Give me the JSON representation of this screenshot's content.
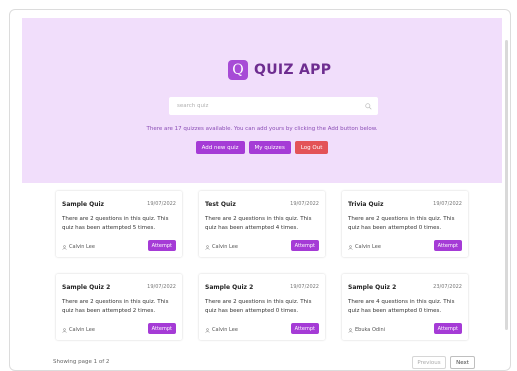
{
  "app": {
    "title": "QUIZ APP",
    "logo_letter": "Q"
  },
  "search": {
    "placeholder": "search quiz"
  },
  "info_text": "There are 17 quizzes available. You can add yours by clicking the Add button below.",
  "buttons": {
    "add": "Add new quiz",
    "mine": "My quizzes",
    "logout": "Log Out"
  },
  "quizzes": [
    {
      "title": "Sample Quiz",
      "date": "19/07/2022",
      "desc": "There are 2 questions in this quiz. This quiz has been attempted 5 times.",
      "author": "Calvin Lee",
      "action": "Attempt"
    },
    {
      "title": "Test Quiz",
      "date": "19/07/2022",
      "desc": "There are 2 questions in this quiz. This quiz has been attempted 4 times.",
      "author": "Calvin Lee",
      "action": "Attempt"
    },
    {
      "title": "Trivia Quiz",
      "date": "19/07/2022",
      "desc": "There are 2 questions in this quiz. This quiz has been attempted 0 times.",
      "author": "Calvin Lee",
      "action": "Attempt"
    },
    {
      "title": "Sample Quiz 2",
      "date": "19/07/2022",
      "desc": "There are 2 questions in this quiz. This quiz has been attempted 2 times.",
      "author": "Calvin Lee",
      "action": "Attempt"
    },
    {
      "title": "Sample Quiz 2",
      "date": "19/07/2022",
      "desc": "There are 2 questions in this quiz. This quiz has been attempted 0 times.",
      "author": "Calvin Lee",
      "action": "Attempt"
    },
    {
      "title": "Sample Quiz 2",
      "date": "23/07/2022",
      "desc": "There are 4 questions in this quiz. This quiz has been attempted 0 times.",
      "author": "Ebuka Odini",
      "action": "Attempt"
    }
  ],
  "pagination": {
    "status": "Showing page 1 of 2",
    "prev": "Previous",
    "next": "Next"
  },
  "colors": {
    "hero_bg": "#f1defb",
    "accent": "#a53bd6",
    "danger": "#e35357",
    "title": "#6e2d90"
  }
}
